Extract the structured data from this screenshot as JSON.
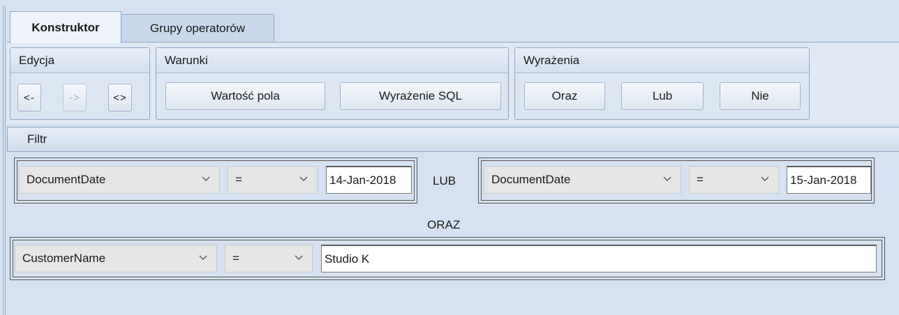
{
  "tabs": [
    {
      "label": "Konstruktor",
      "active": true
    },
    {
      "label": "Grupy operatorów",
      "active": false
    }
  ],
  "groups": {
    "edycja": {
      "title": "Edycja",
      "buttons": [
        {
          "label": "<-",
          "enabled": true
        },
        {
          "label": "->",
          "enabled": false
        },
        {
          "label": "<>",
          "enabled": true
        }
      ]
    },
    "warunki": {
      "title": "Warunki",
      "buttons": [
        {
          "label": "Wartość pola"
        },
        {
          "label": "Wyrażenie SQL"
        }
      ]
    },
    "wyrazenia": {
      "title": "Wyrażenia",
      "buttons": [
        {
          "label": "Oraz"
        },
        {
          "label": "Lub"
        },
        {
          "label": "Nie"
        }
      ]
    }
  },
  "filter": {
    "title": "Filtr",
    "or_group": {
      "left": {
        "field": "DocumentDate",
        "operator": "=",
        "value": "14-Jan-2018"
      },
      "connector": "LUB",
      "right": {
        "field": "DocumentDate",
        "operator": "=",
        "value": "15-Jan-2018"
      }
    },
    "and_connector": "ORAZ",
    "second": {
      "field": "CustomerName",
      "operator": "=",
      "value": "Studio K"
    }
  },
  "icons": {
    "dropdown": "chevron-down-icon"
  }
}
